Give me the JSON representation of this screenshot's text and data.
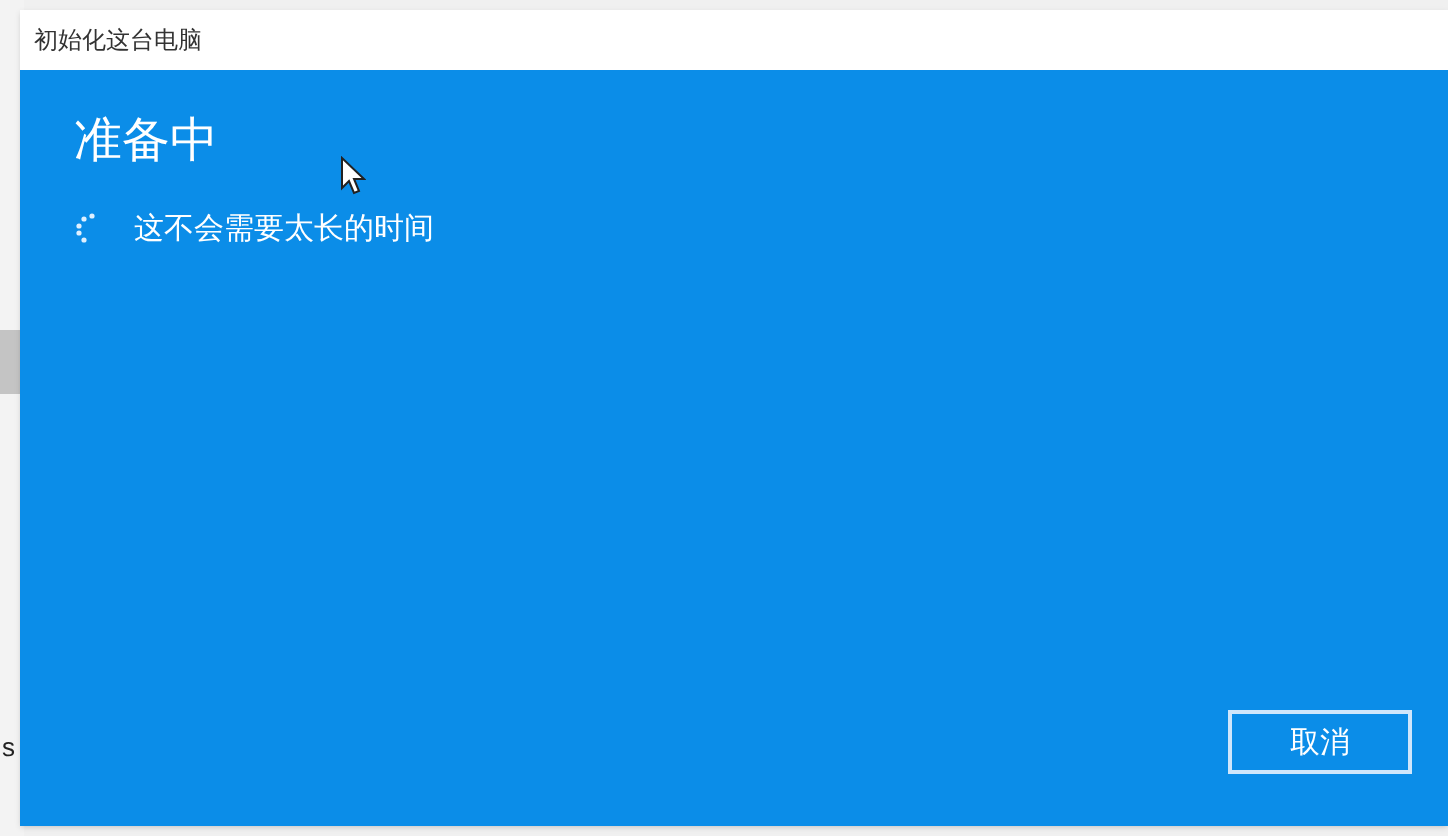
{
  "background_window": {
    "fragment": "s"
  },
  "dialog": {
    "title": "初始化这台电脑",
    "heading": "准备中",
    "message": "这不会需要太长的时间",
    "buttons": [
      {
        "label": "取消"
      }
    ]
  }
}
